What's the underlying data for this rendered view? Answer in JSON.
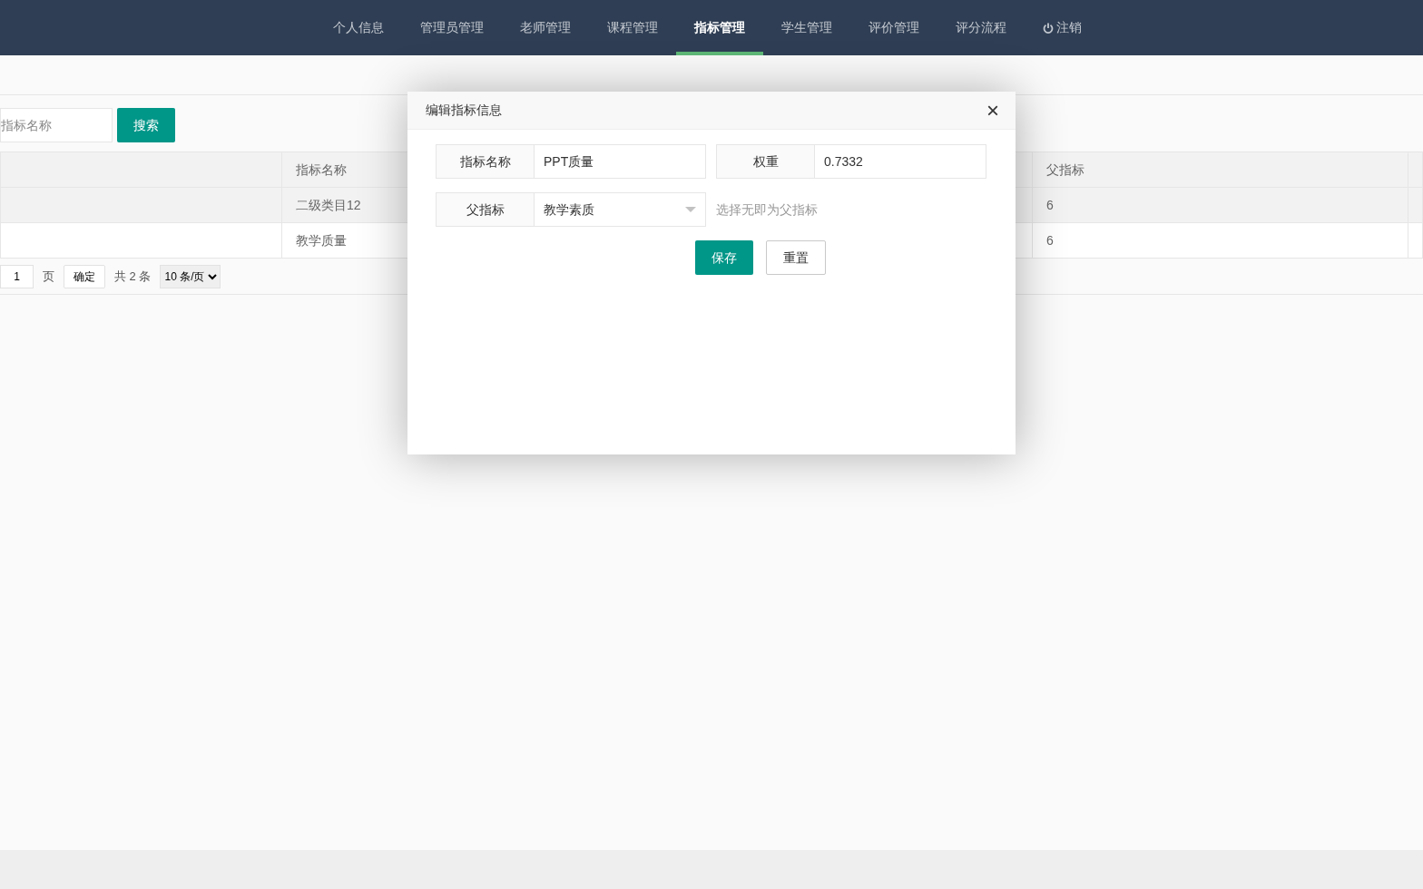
{
  "nav": {
    "items": [
      {
        "label": "个人信息",
        "kind": "link",
        "selected": false
      },
      {
        "label": "管理员管理",
        "kind": "link",
        "selected": false
      },
      {
        "label": "老师管理",
        "kind": "link",
        "selected": false
      },
      {
        "label": "课程管理",
        "kind": "link",
        "selected": false
      },
      {
        "label": "指标管理",
        "kind": "link",
        "selected": true
      },
      {
        "label": "学生管理",
        "kind": "link",
        "selected": false
      },
      {
        "label": "评价管理",
        "kind": "link",
        "selected": false
      },
      {
        "label": "评分流程",
        "kind": "link",
        "selected": false
      },
      {
        "label": "注销",
        "kind": "logout",
        "selected": false
      }
    ]
  },
  "search": {
    "placeholder": "指标名称",
    "button": "搜索"
  },
  "table": {
    "columns": [
      "",
      "指标名称",
      "父指标",
      ""
    ],
    "rows": [
      {
        "cells": [
          "",
          "二级类目12",
          "6",
          ""
        ],
        "selected": true
      },
      {
        "cells": [
          "",
          "教学质量",
          "6",
          ""
        ],
        "selected": false
      }
    ]
  },
  "pagination": {
    "page": "1",
    "page_label": "页",
    "go_button": "确定",
    "total": "共 2 条",
    "page_size": "10 条/页"
  },
  "dialog": {
    "title": "编辑指标信息",
    "close": "×",
    "fields": [
      {
        "label": "指标名称",
        "value": "PPT质量",
        "kind": "text"
      },
      {
        "label": "权重",
        "value": "0.7332",
        "kind": "text"
      },
      {
        "label": "父指标",
        "value": "教学素质",
        "kind": "select",
        "hint": "选择无即为父指标"
      }
    ],
    "buttons": [
      {
        "label": "保存",
        "kind": "primary"
      },
      {
        "label": "重置",
        "kind": "secondary"
      }
    ]
  }
}
